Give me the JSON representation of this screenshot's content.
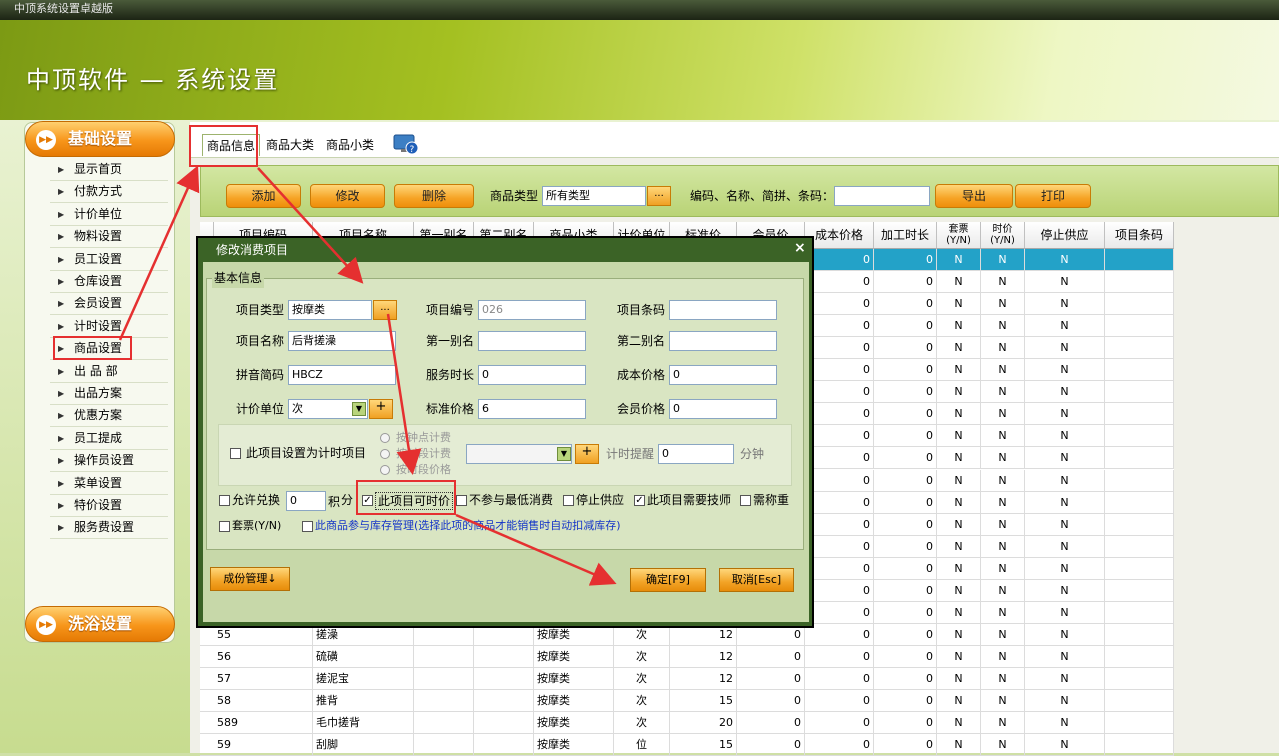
{
  "window_title": "中顶系统设置卓越版",
  "app_title": "中顶软件 — 系统设置",
  "sidebar": {
    "section1": "基础设置",
    "items": [
      "显示首页",
      "付款方式",
      "计价单位",
      "物料设置",
      "员工设置",
      "仓库设置",
      "会员设置",
      "计时设置",
      "商品设置",
      "出 品 部",
      "出品方案",
      "优惠方案",
      "员工提成",
      "操作员设置",
      "菜单设置",
      "特价设置",
      "服务费设置"
    ],
    "section2": "洗浴设置"
  },
  "tabs": [
    "商品信息",
    "商品大类",
    "商品小类"
  ],
  "toolbar": {
    "add": "添加",
    "edit": "修改",
    "delete": "删除",
    "type_label": "商品类型",
    "type_value": "所有类型",
    "dots": "...",
    "search_label": "编码、名称、简拼、条码：",
    "search_value": "",
    "export": "导出",
    "print": "打印"
  },
  "grid": {
    "headers": [
      "项目编码",
      "项目名称",
      "第一别名",
      "第二别名",
      "商品小类",
      "计价单位",
      "标准价",
      "会员价",
      "成本价格",
      "加工时长",
      "套票(Y/N)",
      "时价(Y/N)",
      "停止供应",
      "项目条码"
    ],
    "bg_rows": [
      {
        "cost": "0",
        "time": "0",
        "pkg": "N",
        "tp": "N",
        "stop": "N"
      },
      {
        "cost": "0",
        "time": "0",
        "pkg": "N",
        "tp": "N",
        "stop": "N"
      },
      {
        "cost": "0",
        "time": "0",
        "pkg": "N",
        "tp": "N",
        "stop": "N"
      },
      {
        "cost": "0",
        "time": "0",
        "pkg": "N",
        "tp": "N",
        "stop": "N"
      },
      {
        "cost": "0",
        "time": "0",
        "pkg": "N",
        "tp": "N",
        "stop": "N"
      },
      {
        "cost": "0",
        "time": "0",
        "pkg": "N",
        "tp": "N",
        "stop": "N"
      },
      {
        "cost": "0",
        "time": "0",
        "pkg": "N",
        "tp": "N",
        "stop": "N"
      },
      {
        "cost": "0",
        "time": "0",
        "pkg": "N",
        "tp": "N",
        "stop": "N"
      },
      {
        "cost": "0",
        "time": "0",
        "pkg": "N",
        "tp": "N",
        "stop": "N"
      },
      {
        "cost": "0",
        "time": "0",
        "pkg": "N",
        "tp": "N",
        "stop": "N"
      },
      {
        "cost": "0",
        "time": "0",
        "pkg": "N",
        "tp": "N",
        "stop": "N"
      },
      {
        "cost": "0",
        "time": "0",
        "pkg": "N",
        "tp": "N",
        "stop": "N"
      },
      {
        "cost": "0",
        "time": "0",
        "pkg": "N",
        "tp": "N",
        "stop": "N"
      },
      {
        "cost": "0",
        "time": "0",
        "pkg": "N",
        "tp": "N",
        "stop": "N"
      },
      {
        "cost": "0",
        "time": "0",
        "pkg": "N",
        "tp": "N",
        "stop": "N"
      },
      {
        "cost": "0",
        "time": "0",
        "pkg": "N",
        "tp": "N",
        "stop": "N"
      },
      {
        "cost": "0",
        "time": "0",
        "pkg": "N",
        "tp": "N",
        "stop": "N"
      }
    ],
    "rows": [
      {
        "code": "55",
        "name": "搓澡",
        "sub": "按摩类",
        "unit": "次",
        "price": "12",
        "member": "0",
        "cost": "0",
        "time": "0",
        "pkg": "N",
        "tp": "N",
        "stop": "N"
      },
      {
        "code": "56",
        "name": "硫磺",
        "sub": "按摩类",
        "unit": "次",
        "price": "12",
        "member": "0",
        "cost": "0",
        "time": "0",
        "pkg": "N",
        "tp": "N",
        "stop": "N"
      },
      {
        "code": "57",
        "name": "搓泥宝",
        "sub": "按摩类",
        "unit": "次",
        "price": "12",
        "member": "0",
        "cost": "0",
        "time": "0",
        "pkg": "N",
        "tp": "N",
        "stop": "N"
      },
      {
        "code": "58",
        "name": "推背",
        "sub": "按摩类",
        "unit": "次",
        "price": "15",
        "member": "0",
        "cost": "0",
        "time": "0",
        "pkg": "N",
        "tp": "N",
        "stop": "N"
      },
      {
        "code": "589",
        "name": "毛巾搓背",
        "sub": "按摩类",
        "unit": "次",
        "price": "20",
        "member": "0",
        "cost": "0",
        "time": "0",
        "pkg": "N",
        "tp": "N",
        "stop": "N"
      },
      {
        "code": "59",
        "name": "刮脚",
        "sub": "按摩类",
        "unit": "位",
        "price": "15",
        "member": "0",
        "cost": "0",
        "time": "0",
        "pkg": "N",
        "tp": "N",
        "stop": "N"
      }
    ]
  },
  "dialog": {
    "title": "修改消费项目",
    "close": "×",
    "group": "基本信息",
    "type_label": "项目类型",
    "type_value": "按摩类",
    "dots": "...",
    "code_label": "项目编号",
    "code_value": "026",
    "barcode_label": "项目条码",
    "barcode_value": "",
    "name_label": "项目名称",
    "name_value": "后背搓澡",
    "alias1_label": "第一别名",
    "alias1_value": "",
    "alias2_label": "第二别名",
    "alias2_value": "",
    "pinyin_label": "拼音简码",
    "pinyin_value": "HBCZ",
    "duration_label": "服务时长",
    "duration_value": "0",
    "cost_label": "成本价格",
    "cost_value": "0",
    "unit_label": "计价单位",
    "unit_value": "次",
    "plus": "+",
    "std_price_label": "标准价格",
    "std_price_value": "6",
    "member_price_label": "会员价格",
    "member_price_value": "0",
    "timed_item_label": "此项目设置为计时项目",
    "radio1": "按钟点计费",
    "radio2": "按时段计费",
    "radio3": "按时段价格",
    "timer_remind_label": "计时提醒",
    "timer_remind_value": "0",
    "minutes": "分钟",
    "allow_exchange": "允许兑换",
    "exchange_value": "0",
    "points_unit": "积",
    "points_label": "分",
    "time_price": "此项目可时价",
    "no_min_spend": "不参与最低消费",
    "stop_supply": "停止供应",
    "need_tech": "此项目需要技师",
    "need_weigh": "需称重",
    "package": "套票(Y/N)",
    "stock_mgmt": "此商品参与库存管理(选择此项的商品才能销售时自动扣减库存)",
    "components_btn": "成份管理↓",
    "ok_btn": "确定[F9]",
    "cancel_btn": "取消[Esc]"
  }
}
